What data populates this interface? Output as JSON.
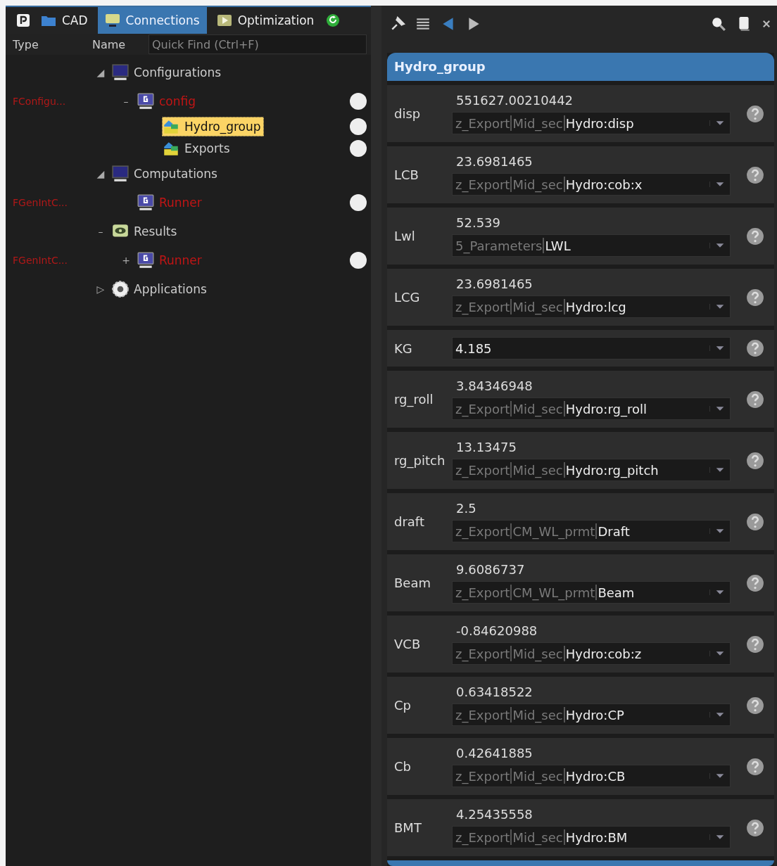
{
  "tabs": [
    {
      "label": "CAD",
      "kind": "folder",
      "selected": false
    },
    {
      "label": "Connections",
      "kind": "monitor",
      "selected": true
    },
    {
      "label": "Optimization",
      "kind": "play",
      "selected": false
    }
  ],
  "columns": {
    "type": "Type",
    "name": "Name",
    "search_placeholder": "Quick Find (Ctrl+F)"
  },
  "tree": [
    {
      "name": "Configurations",
      "kind": "monitor",
      "expander": "◢",
      "children": [
        {
          "type": "FConfigu...",
          "name": "config",
          "kind": "g-monitor",
          "expander": "–",
          "error": true,
          "status_dot": true,
          "children": [
            {
              "name": "Hydro_group",
              "kind": "group",
              "selected": true,
              "status_dot": true
            },
            {
              "name": "Exports",
              "kind": "group",
              "selected": false,
              "status_dot": true
            }
          ]
        }
      ]
    },
    {
      "name": "Computations",
      "kind": "monitor",
      "expander": "◢",
      "children": [
        {
          "type": "FGenIntC...",
          "name": "Runner",
          "kind": "g-monitor",
          "error": true,
          "status_dot": true
        }
      ]
    },
    {
      "name": "Results",
      "kind": "eye",
      "expander": "–",
      "children": [
        {
          "type": "FGenIntC...",
          "name": "Runner",
          "kind": "g-monitor",
          "expander": "+",
          "error": true,
          "status_dot": true
        }
      ]
    },
    {
      "name": "Applications",
      "kind": "gear",
      "expander": "▷"
    }
  ],
  "panel": {
    "title": "Hydro_group",
    "rows": [
      {
        "label": "disp",
        "kind": "linked",
        "value": "551627.00210442",
        "link": [
          "z_Export",
          "Mid_sec",
          "Hydro:disp"
        ]
      },
      {
        "label": "LCB",
        "kind": "linked",
        "value": "23.6981465",
        "link": [
          "z_Export",
          "Mid_sec",
          "Hydro:cob:x"
        ]
      },
      {
        "label": "Lwl",
        "kind": "linked",
        "value": "52.539",
        "link": [
          "5_Parameters",
          "LWL"
        ]
      },
      {
        "label": "LCG",
        "kind": "linked",
        "value": "23.6981465",
        "link": [
          "z_Export",
          "Mid_sec",
          "Hydro:lcg"
        ]
      },
      {
        "label": "KG",
        "kind": "input",
        "value": "4.185"
      },
      {
        "label": "rg_roll",
        "kind": "linked",
        "value": "3.84346948",
        "link": [
          "z_Export",
          "Mid_sec",
          "Hydro:rg_roll"
        ]
      },
      {
        "label": "rg_pitch",
        "kind": "linked",
        "value": "13.13475",
        "link": [
          "z_Export",
          "Mid_sec",
          "Hydro:rg_pitch"
        ]
      },
      {
        "label": "draft",
        "kind": "linked",
        "value": "2.5",
        "link": [
          "z_Export",
          "CM_WL_prmt",
          "Draft"
        ]
      },
      {
        "label": "Beam",
        "kind": "linked",
        "value": "9.6086737",
        "link": [
          "z_Export",
          "CM_WL_prmt",
          "Beam"
        ]
      },
      {
        "label": "VCB",
        "kind": "linked",
        "value": "-0.84620988",
        "link": [
          "z_Export",
          "Mid_sec",
          "Hydro:cob:z"
        ]
      },
      {
        "label": "Cp",
        "kind": "linked",
        "value": "0.63418522",
        "link": [
          "z_Export",
          "Mid_sec",
          "Hydro:CP"
        ]
      },
      {
        "label": "Cb",
        "kind": "linked",
        "value": "0.42641885",
        "link": [
          "z_Export",
          "Mid_sec",
          "Hydro:CB"
        ]
      },
      {
        "label": "BMT",
        "kind": "linked",
        "value": "4.25435558",
        "link": [
          "z_Export",
          "Mid_sec",
          "Hydro:BM"
        ]
      }
    ]
  }
}
